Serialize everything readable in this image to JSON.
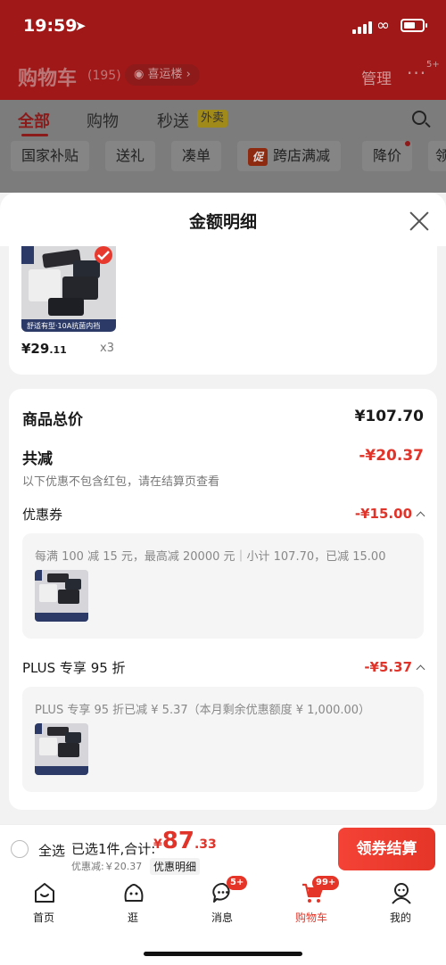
{
  "status_bar": {
    "time": "19:59"
  },
  "background": {
    "title": "购物车",
    "count": "(195)",
    "location": "喜运楼",
    "manage": "管理",
    "more_badge": "5+",
    "tabs": [
      "全部",
      "购物",
      "秒送"
    ],
    "waimai_tag": "外卖",
    "chips": [
      "国家补贴",
      "送礼",
      "凑单",
      "跨店满减",
      "降价",
      "领"
    ],
    "chip_cu": "促"
  },
  "sheet": {
    "title": "金额明细",
    "item": {
      "price_int": "¥29",
      "price_dec": ".11",
      "qty": "x3",
      "img_caption": "舒适有型·10A抗菌内裆"
    },
    "total_label": "商品总价",
    "total_value": "¥107.70",
    "reduce_label": "共减",
    "reduce_value": "-¥20.37",
    "reduce_note": "以下优惠不包含红包，请在结算页查看",
    "coupon_label": "优惠券",
    "coupon_value": "-¥15.00",
    "coupon_detail": "每满 100 减 15 元，最高减 20000 元｜小计 107.70，已减 15.00",
    "plus_label": "PLUS 专享 95 折",
    "plus_value": "-¥5.37",
    "plus_detail": "PLUS 专享 95 折已减 ¥ 5.37（本月剩余优惠额度 ¥ 1,000.00）"
  },
  "bottom": {
    "select_all": "全选",
    "selected": "已选1件,合计:",
    "cur": "¥",
    "total_int": "87",
    "total_dec": ".33",
    "discount": "优惠减:￥20.37",
    "detail_link": "优惠明细",
    "checkout": "领券结算"
  },
  "tabbar": [
    {
      "label": "首页",
      "badge": ""
    },
    {
      "label": "逛",
      "badge": ""
    },
    {
      "label": "消息",
      "badge": "5+"
    },
    {
      "label": "购物车",
      "badge": "99+"
    },
    {
      "label": "我的",
      "badge": ""
    }
  ],
  "colors": {
    "accent": "#e0342a",
    "dim_red": "#a01818"
  }
}
